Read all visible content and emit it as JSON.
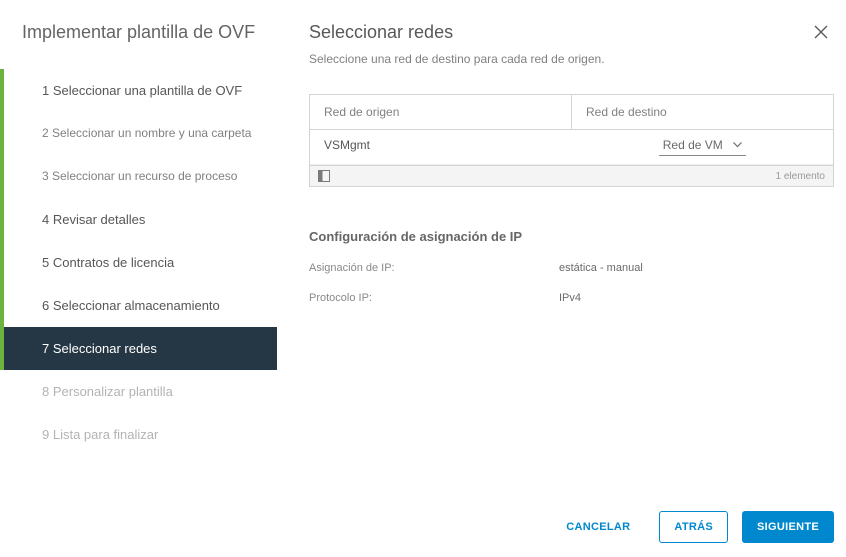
{
  "sidebar": {
    "title": "Implementar plantilla de OVF",
    "steps": [
      {
        "label": "1 Seleccionar una plantilla de OVF",
        "state": "done",
        "size": "large"
      },
      {
        "label": "2 Seleccionar un nombre y una carpeta",
        "state": "done",
        "size": "small"
      },
      {
        "label": "3 Seleccionar un recurso de proceso",
        "state": "done",
        "size": "small"
      },
      {
        "label": "4 Revisar detalles",
        "state": "done",
        "size": "large"
      },
      {
        "label": "5 Contratos de licencia",
        "state": "done",
        "size": "large"
      },
      {
        "label": "6 Seleccionar almacenamiento",
        "state": "done",
        "size": "large"
      },
      {
        "label": "7 Seleccionar redes",
        "state": "active",
        "size": "large"
      },
      {
        "label": "8 Personalizar plantilla",
        "state": "future",
        "size": "large"
      },
      {
        "label": "9 Lista para finalizar",
        "state": "future",
        "size": "large"
      }
    ]
  },
  "main": {
    "title": "Seleccionar redes",
    "subtitle": "Seleccione una red de destino para cada red de origen.",
    "table": {
      "col_source": "Red de origen",
      "col_dest": "Red de destino",
      "rows": [
        {
          "source": "VSMgmt",
          "dest": "Red de VM"
        }
      ],
      "footer_count": "1 elemento"
    },
    "ip_section": {
      "title": "Configuración de asignación de IP",
      "rows": [
        {
          "k": "Asignación de IP:",
          "v": "estática - manual"
        },
        {
          "k": "Protocolo IP:",
          "v": "IPv4"
        }
      ]
    }
  },
  "footer": {
    "cancel": "CANCELAR",
    "back": "ATRÁS",
    "next": "SIGUIENTE"
  }
}
